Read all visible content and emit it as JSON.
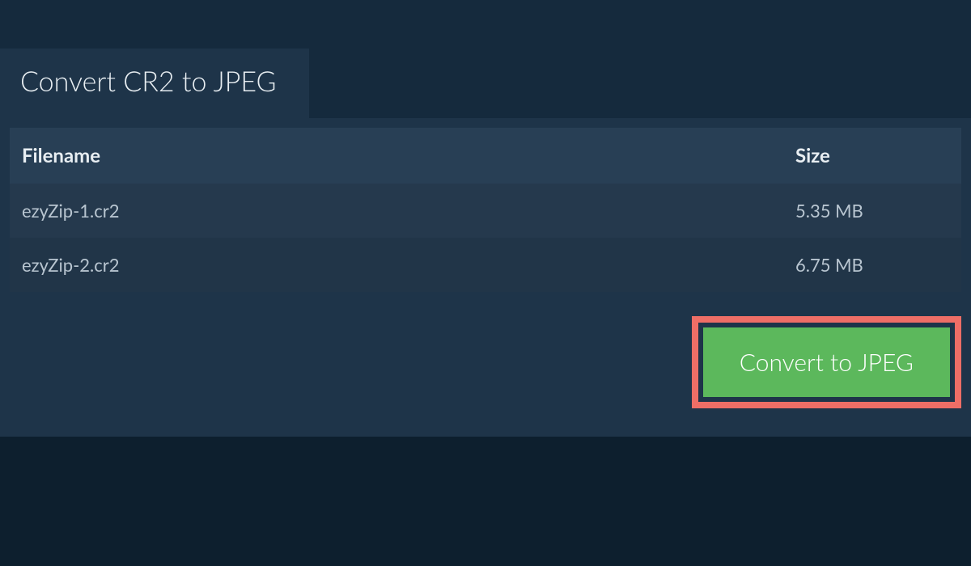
{
  "tab": {
    "title": "Convert CR2 to JPEG"
  },
  "table": {
    "headers": {
      "filename": "Filename",
      "size": "Size"
    },
    "rows": [
      {
        "filename": "ezyZip-1.cr2",
        "size": "5.35 MB"
      },
      {
        "filename": "ezyZip-2.cr2",
        "size": "6.75 MB"
      }
    ]
  },
  "actions": {
    "convert_label": "Convert to JPEG"
  },
  "colors": {
    "background_dark": "#0d1f2e",
    "panel": "#1e3449",
    "row": "#25394d",
    "button_green": "#5cb85c",
    "highlight_border": "#ee6e66"
  }
}
